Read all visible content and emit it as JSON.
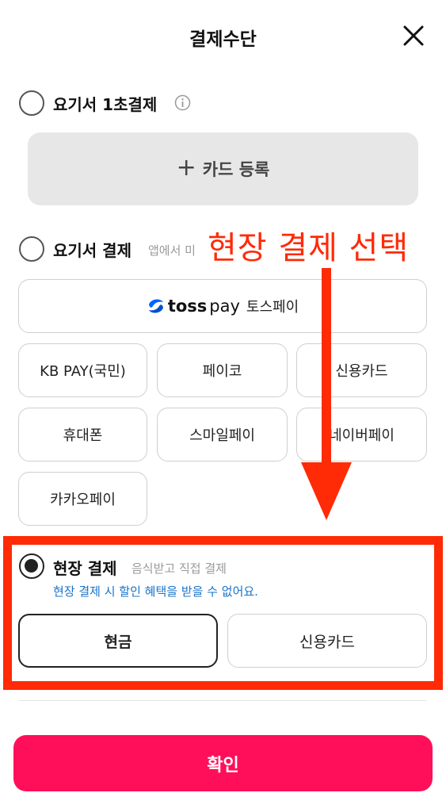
{
  "header": {
    "title": "결제수단"
  },
  "yogiseo_1sec": {
    "title": "요기서 1초결제",
    "add_card_label": "카드 등록"
  },
  "yogiseo_pay": {
    "title": "요기서 결제",
    "subtitle": "앱에서 미",
    "toss": {
      "brand": "toss",
      "brand_pay": "pay",
      "label": "토스페이"
    },
    "methods": [
      "KB PAY(국민)",
      "페이코",
      "신용카드",
      "휴대폰",
      "스마일페이",
      "네이버페이",
      "카카오페이"
    ]
  },
  "onsite": {
    "title": "현장 결제",
    "subtitle": "음식받고 직접 결제",
    "note": "현장 결제 시 할인 혜택을 받을 수 없어요.",
    "options": [
      "현금",
      "신용카드"
    ],
    "selected_option": "현금"
  },
  "confirm_label": "확인",
  "annotation": {
    "text": "현장 결제 선택"
  },
  "colors": {
    "accent": "#ff0f5a",
    "highlight": "#ff2a06",
    "note": "#1a73c9",
    "toss_blue": "#0064ff"
  },
  "icons": [
    "close-icon",
    "info-icon",
    "plus-icon",
    "toss-logo-icon",
    "down-arrow-icon"
  ]
}
